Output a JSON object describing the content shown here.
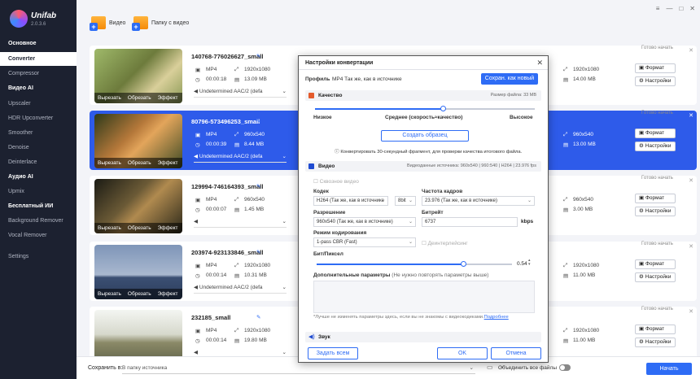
{
  "app": {
    "name": "Unifab",
    "version": "2.0.3.6"
  },
  "sidebar": {
    "items": [
      {
        "label": "Основное",
        "type": "sect"
      },
      {
        "label": "Converter",
        "type": "active"
      },
      {
        "label": "Compressor",
        "type": "item"
      },
      {
        "label": "Видео AI",
        "type": "sect"
      },
      {
        "label": "Upscaler",
        "type": "item"
      },
      {
        "label": "HDR Upconverter",
        "type": "item"
      },
      {
        "label": "Smoother",
        "type": "item"
      },
      {
        "label": "Denoise",
        "type": "item"
      },
      {
        "label": "Deinterlace",
        "type": "item"
      },
      {
        "label": "Аудио AI",
        "type": "sect"
      },
      {
        "label": "Upmix",
        "type": "item"
      },
      {
        "label": "Бесплатный ИИ",
        "type": "sect"
      },
      {
        "label": "Background Remover",
        "type": "item"
      },
      {
        "label": "Vocal Remover",
        "type": "item"
      },
      {
        "label": "Settings",
        "type": "item"
      }
    ]
  },
  "toolbar": {
    "add_video": "Видео",
    "add_folder": "Папку с видео"
  },
  "window_controls": [
    "≡",
    "—",
    "□",
    "✕"
  ],
  "files": [
    {
      "name": "140768-776026627_small",
      "fmt": "MP4",
      "res": "1920x1080",
      "dur": "00:00:18",
      "size": "13.09 MB",
      "audio": "Undetermined AAC/2 (defa",
      "out_res": "1920x1080",
      "out_size": "14.00 MB",
      "status": "Готово начать",
      "tools": [
        "Вырезать",
        "Обрезать",
        "Эффект"
      ]
    },
    {
      "name": "80796-573496253_small",
      "fmt": "MP4",
      "res": "960x540",
      "dur": "00:00:39",
      "size": "8.44 MB",
      "audio": "Undetermined AAC/2 (defa",
      "out_res": "960x540",
      "out_size": "13.00 MB",
      "status": "Готово начать",
      "tools": [
        "Вырезать",
        "Обрезать",
        "Эффект"
      ]
    },
    {
      "name": "129994-746164393_small",
      "fmt": "MP4",
      "res": "960x540",
      "dur": "00:00:07",
      "size": "1.45 MB",
      "audio": "",
      "out_res": "960x540",
      "out_size": "3.00 MB",
      "status": "Готово начать",
      "tools": [
        "Вырезать",
        "Обрезать",
        "Эффект"
      ]
    },
    {
      "name": "203974-923133846_small",
      "fmt": "MP4",
      "res": "1920x1080",
      "dur": "00:00:14",
      "size": "10.31 MB",
      "audio": "Undetermined AAC/2 (defa",
      "out_res": "1920x1080",
      "out_size": "11.00 MB",
      "status": "Готово начать",
      "tools": [
        "Вырезать",
        "Обрезать",
        "Эффект"
      ]
    },
    {
      "name": "232185_small",
      "fmt": "MP4",
      "res": "1920x1080",
      "dur": "00:00:14",
      "size": "19.80 MB",
      "audio": "",
      "out_res": "1920x1080",
      "out_size": "11.00 MB",
      "status": "Готово начать",
      "tools": []
    }
  ],
  "row_buttons": {
    "format": "Формат",
    "settings": "Настройки"
  },
  "dialog": {
    "title": "Настройки конвертации",
    "profile_label": "Профиль",
    "profile_value": "MP4 Так же, как в источнике",
    "save_new": "Сохран. как новый",
    "quality_title": "Качество",
    "quality_right": "Размер файла:  33 MB",
    "quality_low": "Низкое",
    "quality_mid": "Среднее (скорость≈качество)",
    "quality_high": "Высокое",
    "create_sample": "Создать образец",
    "sample_note": "Конвертировать 30-секундный фрагмент, для проверки качества итогового файла.",
    "video_title": "Видео",
    "video_source": "Видеоданные источника: 960x540 | 960:540 | H264 | 23.976 fps",
    "passthrough": "Сквозное видео",
    "codec_label": "Кодек",
    "codec_value": "H264 (Так же, как в источнике",
    "bitdepth": "8bit",
    "fps_label": "Частота кадров",
    "fps_value": "23.976 (Так же, как в источнике)",
    "res_label": "Разрешение",
    "res_value": "960x540 (Так же, как в источнике)",
    "bitrate_label": "Битрейт",
    "bitrate_value": "6737",
    "bitrate_unit": "kbps",
    "mode_label": "Режим кодирования",
    "mode_value": "1-pass CBR (Fast)",
    "deinterlace": "Деинтерлейсинг",
    "bpp_label": "Бит/Пиксел",
    "bpp_value": "0.54",
    "bpp_fraction": 0.75,
    "quality_fraction": 0.58,
    "extra_label": "Дополнительные параметры",
    "extra_note": "(Не нужно повторять параметры выше)",
    "warn_note": "*Лучше не изменять параметры здесь, если вы не знакомы с видеокодеками.",
    "warn_link": "Подробнее",
    "audio_title": "Звук",
    "btn_defaults": "Задать всем",
    "btn_ok": "OK",
    "btn_cancel": "Отмена"
  },
  "bottom": {
    "save_label": "Сохранить в:",
    "save_path": "В папку источника",
    "merge": "Объединить все файлы",
    "start": "Начать"
  },
  "colors": {
    "accent": "#2e6cf5",
    "sidebar": "#1c2130",
    "selected_row": "#2e5bea"
  }
}
